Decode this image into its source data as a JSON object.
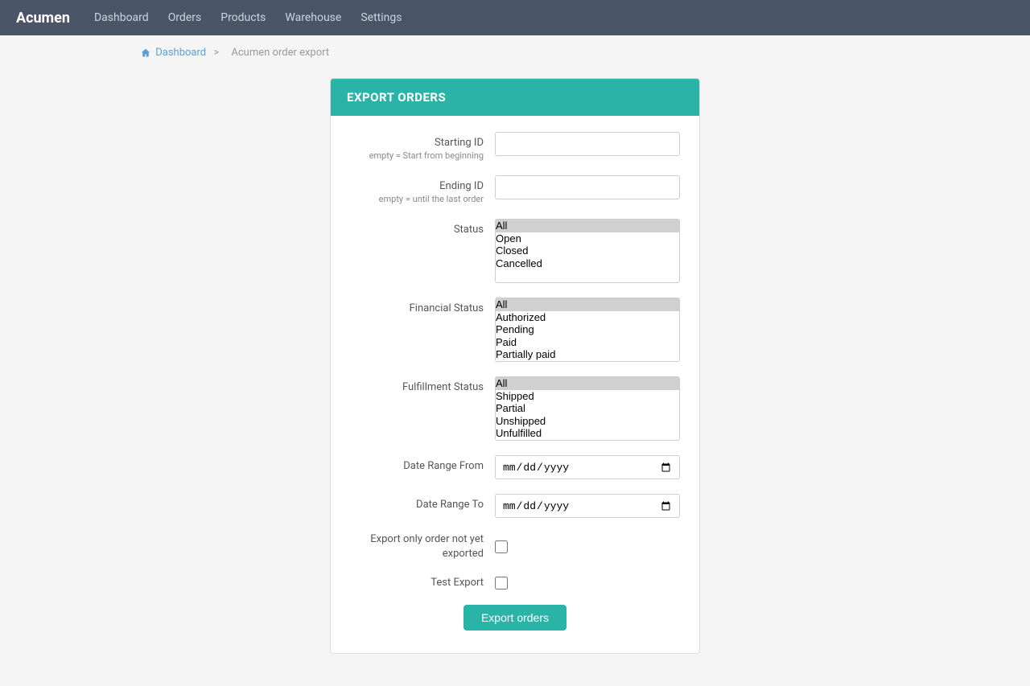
{
  "navbar": {
    "brand": "Acumen",
    "links": [
      "Dashboard",
      "Orders",
      "Products",
      "Warehouse",
      "Settings"
    ]
  },
  "breadcrumb": {
    "home_label": "Dashboard",
    "separator": ">",
    "current": "Acumen order export"
  },
  "form": {
    "card_title": "EXPORT ORDERS",
    "starting_id": {
      "label": "Starting ID",
      "hint": "empty = Start from beginning",
      "placeholder": ""
    },
    "ending_id": {
      "label": "Ending ID",
      "hint": "empty = until the last order",
      "placeholder": ""
    },
    "status": {
      "label": "Status",
      "options": [
        "All",
        "Open",
        "Closed",
        "Cancelled"
      ]
    },
    "financial_status": {
      "label": "Financial Status",
      "options": [
        "All",
        "Authorized",
        "Pending",
        "Paid",
        "Partially paid"
      ]
    },
    "fulfillment_status": {
      "label": "Fulfillment Status",
      "options": [
        "All",
        "Shipped",
        "Partial",
        "Unshipped",
        "Unfulfilled"
      ]
    },
    "date_range_from": {
      "label": "Date Range From",
      "placeholder": "mm/dd/yyyy"
    },
    "date_range_to": {
      "label": "Date Range To",
      "placeholder": "mm/dd/yyyy"
    },
    "export_only": {
      "label": "Export only order not yet exported"
    },
    "test_export": {
      "label": "Test Export"
    },
    "submit_label": "Export orders"
  }
}
